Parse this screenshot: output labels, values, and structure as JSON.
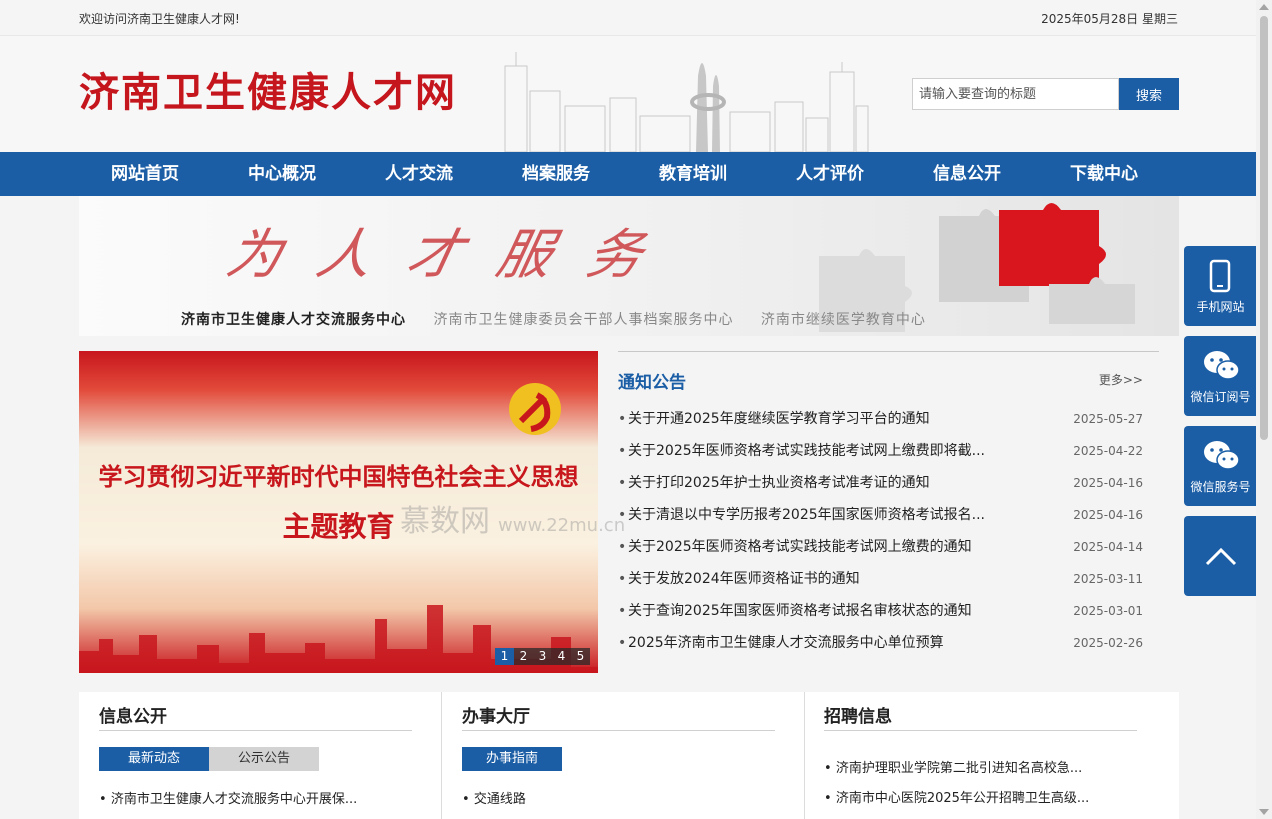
{
  "topbar": {
    "welcome": "欢迎访问济南卫生健康人才网!",
    "date": "2025年05月28日 星期三"
  },
  "header": {
    "logo": "济南卫生健康人才网"
  },
  "search": {
    "placeholder": "请输入要查询的标题",
    "button": "搜索"
  },
  "nav": [
    "网站首页",
    "中心概况",
    "人才交流",
    "档案服务",
    "教育培训",
    "人才评价",
    "信息公开",
    "下载中心"
  ],
  "banner": {
    "slogan": "为人才服务",
    "centers": [
      "济南市卫生健康人才交流服务中心",
      "济南市卫生健康委员会干部人事档案服务中心",
      "济南市继续医学教育中心"
    ]
  },
  "slider": {
    "line1": "学习贯彻习近平新时代中国特色社会主义思想",
    "line2": "主题教育",
    "dots": [
      "1",
      "2",
      "3",
      "4",
      "5"
    ],
    "active": 1
  },
  "watermark": {
    "text": "慕数网",
    "url": "www.22mu.cn"
  },
  "notice": {
    "title": "通知公告",
    "more": "更多>>",
    "items": [
      {
        "title": "关于开通2025年度继续医学教育学习平台的通知",
        "date": "2025-05-27"
      },
      {
        "title": "关于2025年医师资格考试实践技能考试网上缴费即将截...",
        "date": "2025-04-22"
      },
      {
        "title": "关于打印2025年护士执业资格考试准考证的通知",
        "date": "2025-04-16"
      },
      {
        "title": "关于清退以中专学历报考2025年国家医师资格考试报名...",
        "date": "2025-04-16"
      },
      {
        "title": "关于2025年医师资格考试实践技能考试网上缴费的通知",
        "date": "2025-04-14"
      },
      {
        "title": "关于发放2024年医师资格证书的通知",
        "date": "2025-03-11"
      },
      {
        "title": "关于查询2025年国家医师资格考试报名审核状态的通知",
        "date": "2025-03-01"
      },
      {
        "title": "2025年济南市卫生健康人才交流服务中心单位预算",
        "date": "2025-02-26"
      }
    ]
  },
  "columns": {
    "info": {
      "title": "信息公开",
      "tab_active": "最新动态",
      "tab_other": "公示公告",
      "item": "济南市卫生健康人才交流服务中心开展保..."
    },
    "hall": {
      "title": "办事大厅",
      "tab_active": "办事指南",
      "item": "交通线路"
    },
    "jobs": {
      "title": "招聘信息",
      "items": [
        "济南护理职业学院第二批引进知名高校急...",
        "济南市中心医院2025年公开招聘卫生高级..."
      ]
    }
  },
  "side": {
    "mobile": "手机网站",
    "wechat_sub": "微信订阅号",
    "wechat_srv": "微信服务号"
  },
  "colors": {
    "brand_blue": "#1b5ea6",
    "logo_red": "#c4161c"
  }
}
